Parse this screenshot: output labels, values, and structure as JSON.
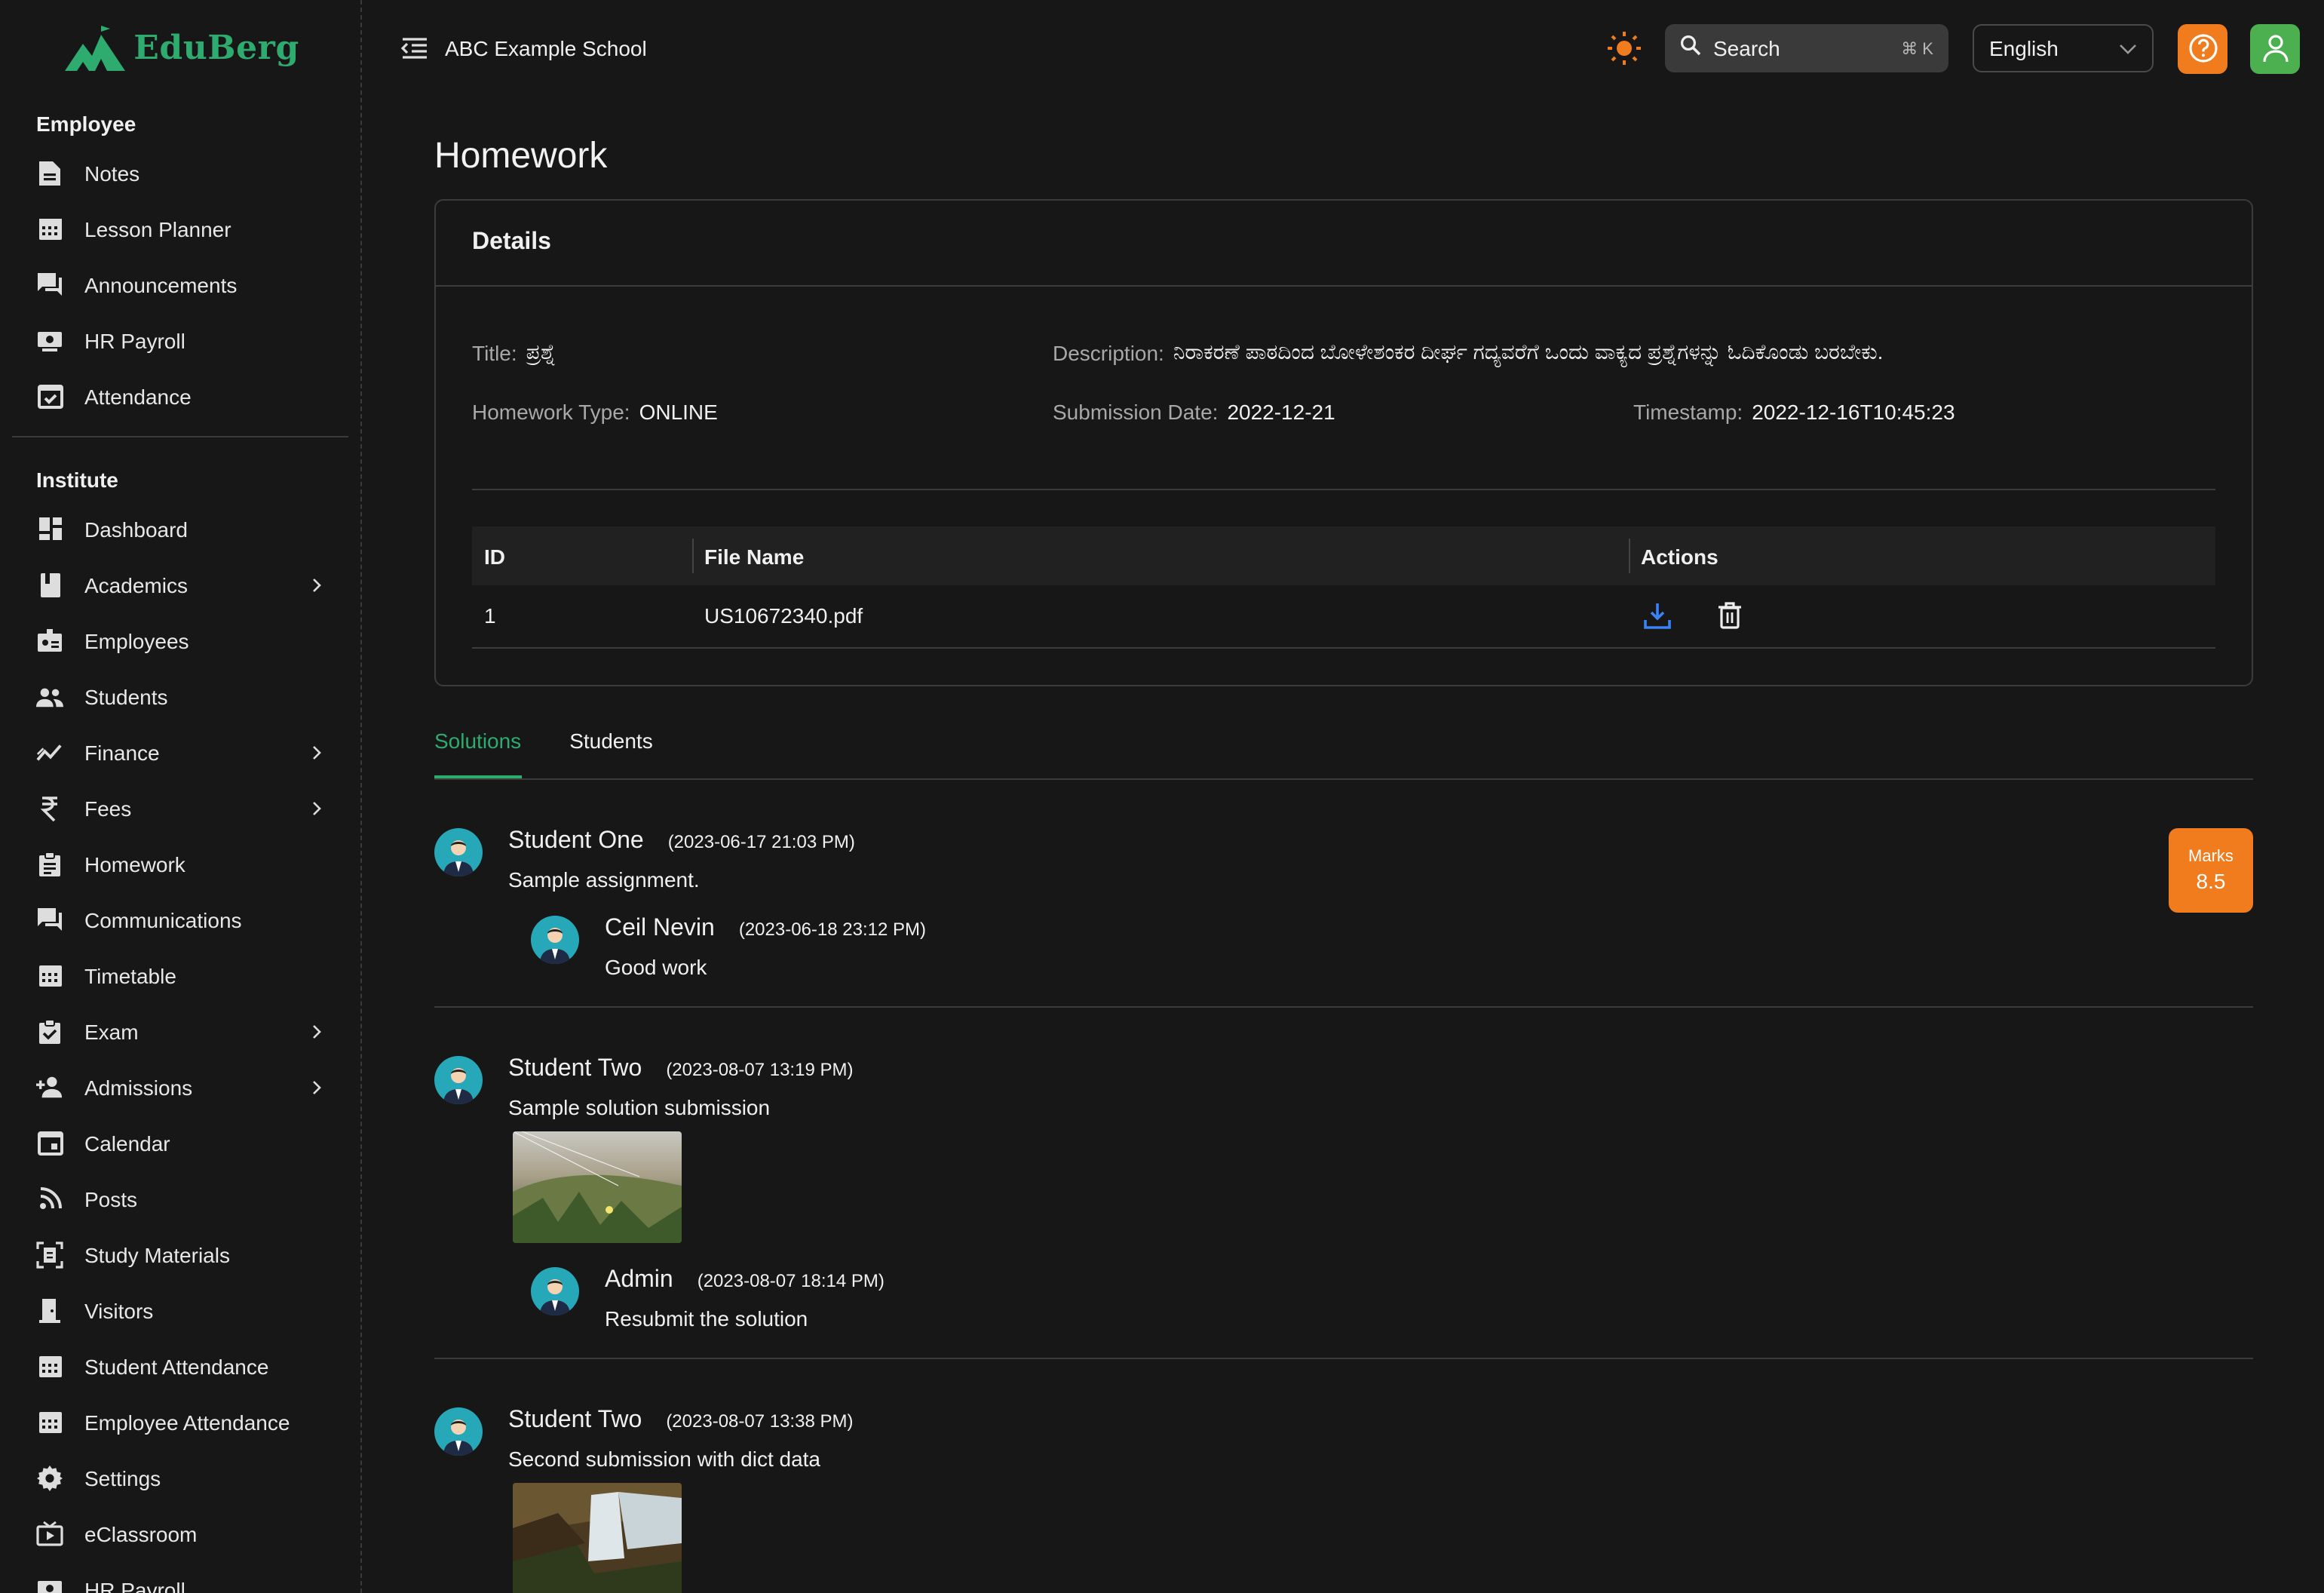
{
  "brand": {
    "name": "EduBerg",
    "color": "#2eab6f"
  },
  "topbar": {
    "school_name": "ABC Example School",
    "search_placeholder": "Search",
    "search_shortcut": "⌘ K",
    "language": "English"
  },
  "sidebar": {
    "employee_label": "Employee",
    "employee_items": [
      {
        "label": "Notes",
        "icon": "document-icon"
      },
      {
        "label": "Lesson Planner",
        "icon": "calendar-icon"
      },
      {
        "label": "Announcements",
        "icon": "chat-icon"
      },
      {
        "label": "HR Payroll",
        "icon": "payroll-icon"
      },
      {
        "label": "Attendance",
        "icon": "calendar-check-icon"
      }
    ],
    "institute_label": "Institute",
    "institute_items": [
      {
        "label": "Dashboard",
        "icon": "dashboard-icon",
        "expandable": false
      },
      {
        "label": "Academics",
        "icon": "book-icon",
        "expandable": true
      },
      {
        "label": "Employees",
        "icon": "badge-icon",
        "expandable": false
      },
      {
        "label": "Students",
        "icon": "people-icon",
        "expandable": false
      },
      {
        "label": "Finance",
        "icon": "trend-icon",
        "expandable": true
      },
      {
        "label": "Fees",
        "icon": "rupee-icon",
        "expandable": true
      },
      {
        "label": "Homework",
        "icon": "clipboard-icon",
        "expandable": false
      },
      {
        "label": "Communications",
        "icon": "chat-icon",
        "expandable": false
      },
      {
        "label": "Timetable",
        "icon": "calendar-icon",
        "expandable": false
      },
      {
        "label": "Exam",
        "icon": "clipboard-check-icon",
        "expandable": true
      },
      {
        "label": "Admissions",
        "icon": "person-add-icon",
        "expandable": true
      },
      {
        "label": "Calendar",
        "icon": "event-icon",
        "expandable": false
      },
      {
        "label": "Posts",
        "icon": "rss-icon",
        "expandable": false
      },
      {
        "label": "Study Materials",
        "icon": "materials-icon",
        "expandable": false
      },
      {
        "label": "Visitors",
        "icon": "door-icon",
        "expandable": false
      },
      {
        "label": "Student Attendance",
        "icon": "calendar-icon",
        "expandable": false
      },
      {
        "label": "Employee Attendance",
        "icon": "calendar-icon",
        "expandable": false
      },
      {
        "label": "Settings",
        "icon": "gear-icon",
        "expandable": false
      },
      {
        "label": "eClassroom",
        "icon": "tv-icon",
        "expandable": false
      },
      {
        "label": "HR Payroll",
        "icon": "payroll-icon",
        "expandable": false
      }
    ]
  },
  "page": {
    "title": "Homework",
    "details": {
      "header": "Details",
      "title_label": "Title:",
      "title_value": "ಪ್ರಶ್ನೆ",
      "description_label": "Description:",
      "description_value": "ನಿರಾಕರಣೆ ಪಾಠದಿಂದ ಬೋಳೇಶಂಕರ ದೀರ್ಘ ಗದ್ಯವರೆಗೆ ಒಂದು ವಾಕ್ಯದ ಪ್ರಶ್ನೆಗಳನ್ನು ಓದಿಕೊಂಡು ಬರಬೇಕು.",
      "type_label": "Homework Type:",
      "type_value": "ONLINE",
      "submission_label": "Submission Date:",
      "submission_value": "2022-12-21",
      "timestamp_label": "Timestamp:",
      "timestamp_value": "2022-12-16T10:45:23"
    },
    "files_table": {
      "columns": [
        "ID",
        "File Name",
        "Actions"
      ],
      "rows": [
        {
          "id": "1",
          "file_name": "US10672340.pdf"
        }
      ]
    },
    "tabs": [
      {
        "label": "Solutions",
        "active": true
      },
      {
        "label": "Students",
        "active": false
      }
    ],
    "solutions": [
      {
        "name": "Student One",
        "timestamp": "(2023-06-17 21:03 PM)",
        "text": "Sample assignment.",
        "marks_label": "Marks",
        "marks_value": "8.5",
        "reply": {
          "name": "Ceil Nevin",
          "timestamp": "(2023-06-18 23:12 PM)",
          "text": "Good work"
        }
      },
      {
        "name": "Student Two",
        "timestamp": "(2023-08-07 13:19 PM)",
        "text": "Sample solution submission",
        "reply": {
          "name": "Admin",
          "timestamp": "(2023-08-07 18:14 PM)",
          "text": "Resubmit the solution"
        }
      },
      {
        "name": "Student Two",
        "timestamp": "(2023-08-07 13:38 PM)",
        "text": "Second submission with dict data"
      }
    ]
  },
  "colors": {
    "accent_orange": "#f07c1e",
    "avatar_teal": "#27a8b8",
    "active_tab": "#2eab6f",
    "user_green": "#4caf50",
    "download_blue": "#3b82f6"
  }
}
